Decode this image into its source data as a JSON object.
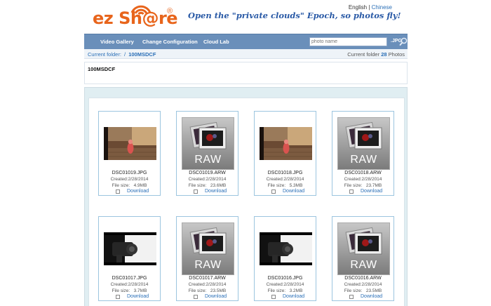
{
  "header": {
    "logo_text": "ez Sh@re",
    "logo_registered": "®",
    "slogan": "Open the \"private clouds\" Epoch, so photos fly!",
    "lang_en": "English",
    "lang_sep": "|",
    "lang_cn": "Chinese",
    "brand_color": "#e8651c"
  },
  "nav": {
    "items": [
      "Video Gallery",
      "Change Configuration",
      "Cloud Lab"
    ],
    "search_placeholder": "photo name",
    "search_ext": ".JPG",
    "search_icon": "magnifier-icon",
    "bar_color": "#6a8fba"
  },
  "breadcrumb": {
    "label": "Current folder:",
    "sep": "/",
    "folder": "100MSDCF",
    "count_prefix": "Current folder",
    "count": "28",
    "count_suffix": "Photos"
  },
  "folder_panel": {
    "name": "100MSDCF"
  },
  "files": [
    {
      "name": "DSC01019.JPG",
      "created": "Created:2/28/2014",
      "size_label": "File size:",
      "size": "4.9MB",
      "download": "Download",
      "thumb": "photo-parrot"
    },
    {
      "name": "DSC01019.ARW",
      "created": "Created:2/28/2014",
      "size_label": "File size:",
      "size": "23.6MB",
      "download": "Download",
      "thumb": "raw",
      "raw_text": "RAW"
    },
    {
      "name": "DSC01018.JPG",
      "created": "Created:2/28/2014",
      "size_label": "File size:",
      "size": "5.3MB",
      "download": "Download",
      "thumb": "photo-parrot"
    },
    {
      "name": "DSC01018.ARW",
      "created": "Created:2/28/2014",
      "size_label": "File size:",
      "size": "23.7MB",
      "download": "Download",
      "thumb": "raw",
      "raw_text": "RAW"
    },
    {
      "name": "DSC01017.JPG",
      "created": "Created:2/28/2014",
      "size_label": "File size:",
      "size": "3.7MB",
      "download": "Download",
      "thumb": "photo-camera"
    },
    {
      "name": "DSC01017.ARW",
      "created": "Created:2/28/2014",
      "size_label": "File size:",
      "size": "23.5MB",
      "download": "Download",
      "thumb": "raw",
      "raw_text": "RAW"
    },
    {
      "name": "DSC01016.JPG",
      "created": "Created:2/28/2014",
      "size_label": "File size:",
      "size": "3.2MB",
      "download": "Download",
      "thumb": "photo-camera"
    },
    {
      "name": "DSC01016.ARW",
      "created": "Created:2/28/2014",
      "size_label": "File size:",
      "size": "23.5MB",
      "download": "Download",
      "thumb": "raw",
      "raw_text": "RAW"
    }
  ]
}
